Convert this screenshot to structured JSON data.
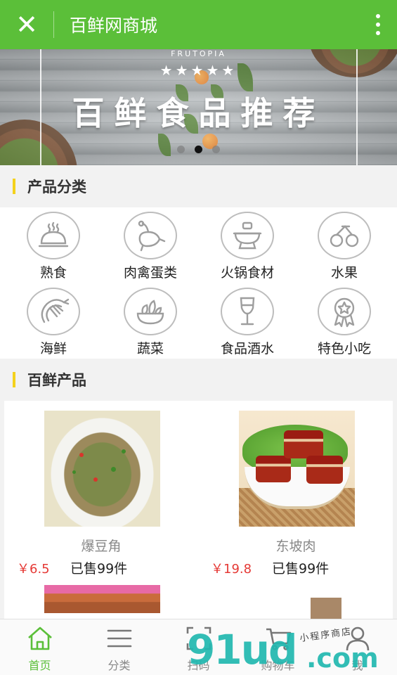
{
  "topbar": {
    "close_glyph": "✕",
    "title": "百鲜网商城",
    "more_icon": "more-vertical-icon",
    "bg_color": "#5bbf39"
  },
  "banner": {
    "brand": "FRUTOPIA",
    "stars": "★★★★★",
    "title": "百鲜食品推荐",
    "slide_count": 3,
    "active_slide": 2
  },
  "sections": {
    "categories_title": "产品分类",
    "products_title": "百鲜产品"
  },
  "categories": [
    {
      "label": "熟食",
      "icon": "food-cloche-icon"
    },
    {
      "label": "肉禽蛋类",
      "icon": "chicken-icon"
    },
    {
      "label": "火锅食材",
      "icon": "hotpot-icon"
    },
    {
      "label": "水果",
      "icon": "cherry-icon"
    },
    {
      "label": "海鲜",
      "icon": "shrimp-icon"
    },
    {
      "label": "蔬菜",
      "icon": "vegetable-bowl-icon"
    },
    {
      "label": "食品酒水",
      "icon": "wine-glass-icon"
    },
    {
      "label": "特色小吃",
      "icon": "award-badge-icon"
    }
  ],
  "products": [
    {
      "name": "爆豆角",
      "price": "￥6.5",
      "sold": "已售99件"
    },
    {
      "name": "东坡肉",
      "price": "￥19.8",
      "sold": "已售99件"
    }
  ],
  "tabs": [
    {
      "label": "首页",
      "icon": "home-icon",
      "active": true
    },
    {
      "label": "分类",
      "icon": "menu-list-icon",
      "active": false
    },
    {
      "label": "扫码",
      "icon": "scan-icon",
      "active": false
    },
    {
      "label": "购物车",
      "icon": "cart-icon",
      "active": false
    },
    {
      "label": "我",
      "icon": "user-icon",
      "active": false
    }
  ],
  "watermark": {
    "main": "91ud",
    "domain": ".com",
    "tagline": "小程序商店"
  },
  "colors": {
    "accent_green": "#5bbf39",
    "section_bar_yellow": "#f4d21c",
    "price_red": "#e53935",
    "watermark_teal": "#22b8b0"
  }
}
